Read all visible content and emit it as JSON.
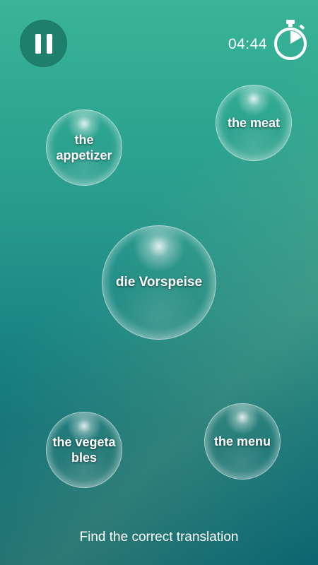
{
  "header": {
    "pause_icon": "pause-icon",
    "timer": "04:44",
    "timer_icon": "stopwatch-icon"
  },
  "bubbles": {
    "prompt": "die Vorspeise",
    "options": [
      {
        "label": "the appetizer"
      },
      {
        "label": "the meat"
      },
      {
        "label": "the vegetables"
      },
      {
        "label": "the menu"
      }
    ]
  },
  "footer": {
    "instruction": "Find the correct translation"
  },
  "colors": {
    "pause_button_bg": "#1f7f6d",
    "background_top": "#3bb598",
    "background_bottom": "#0a6570"
  }
}
